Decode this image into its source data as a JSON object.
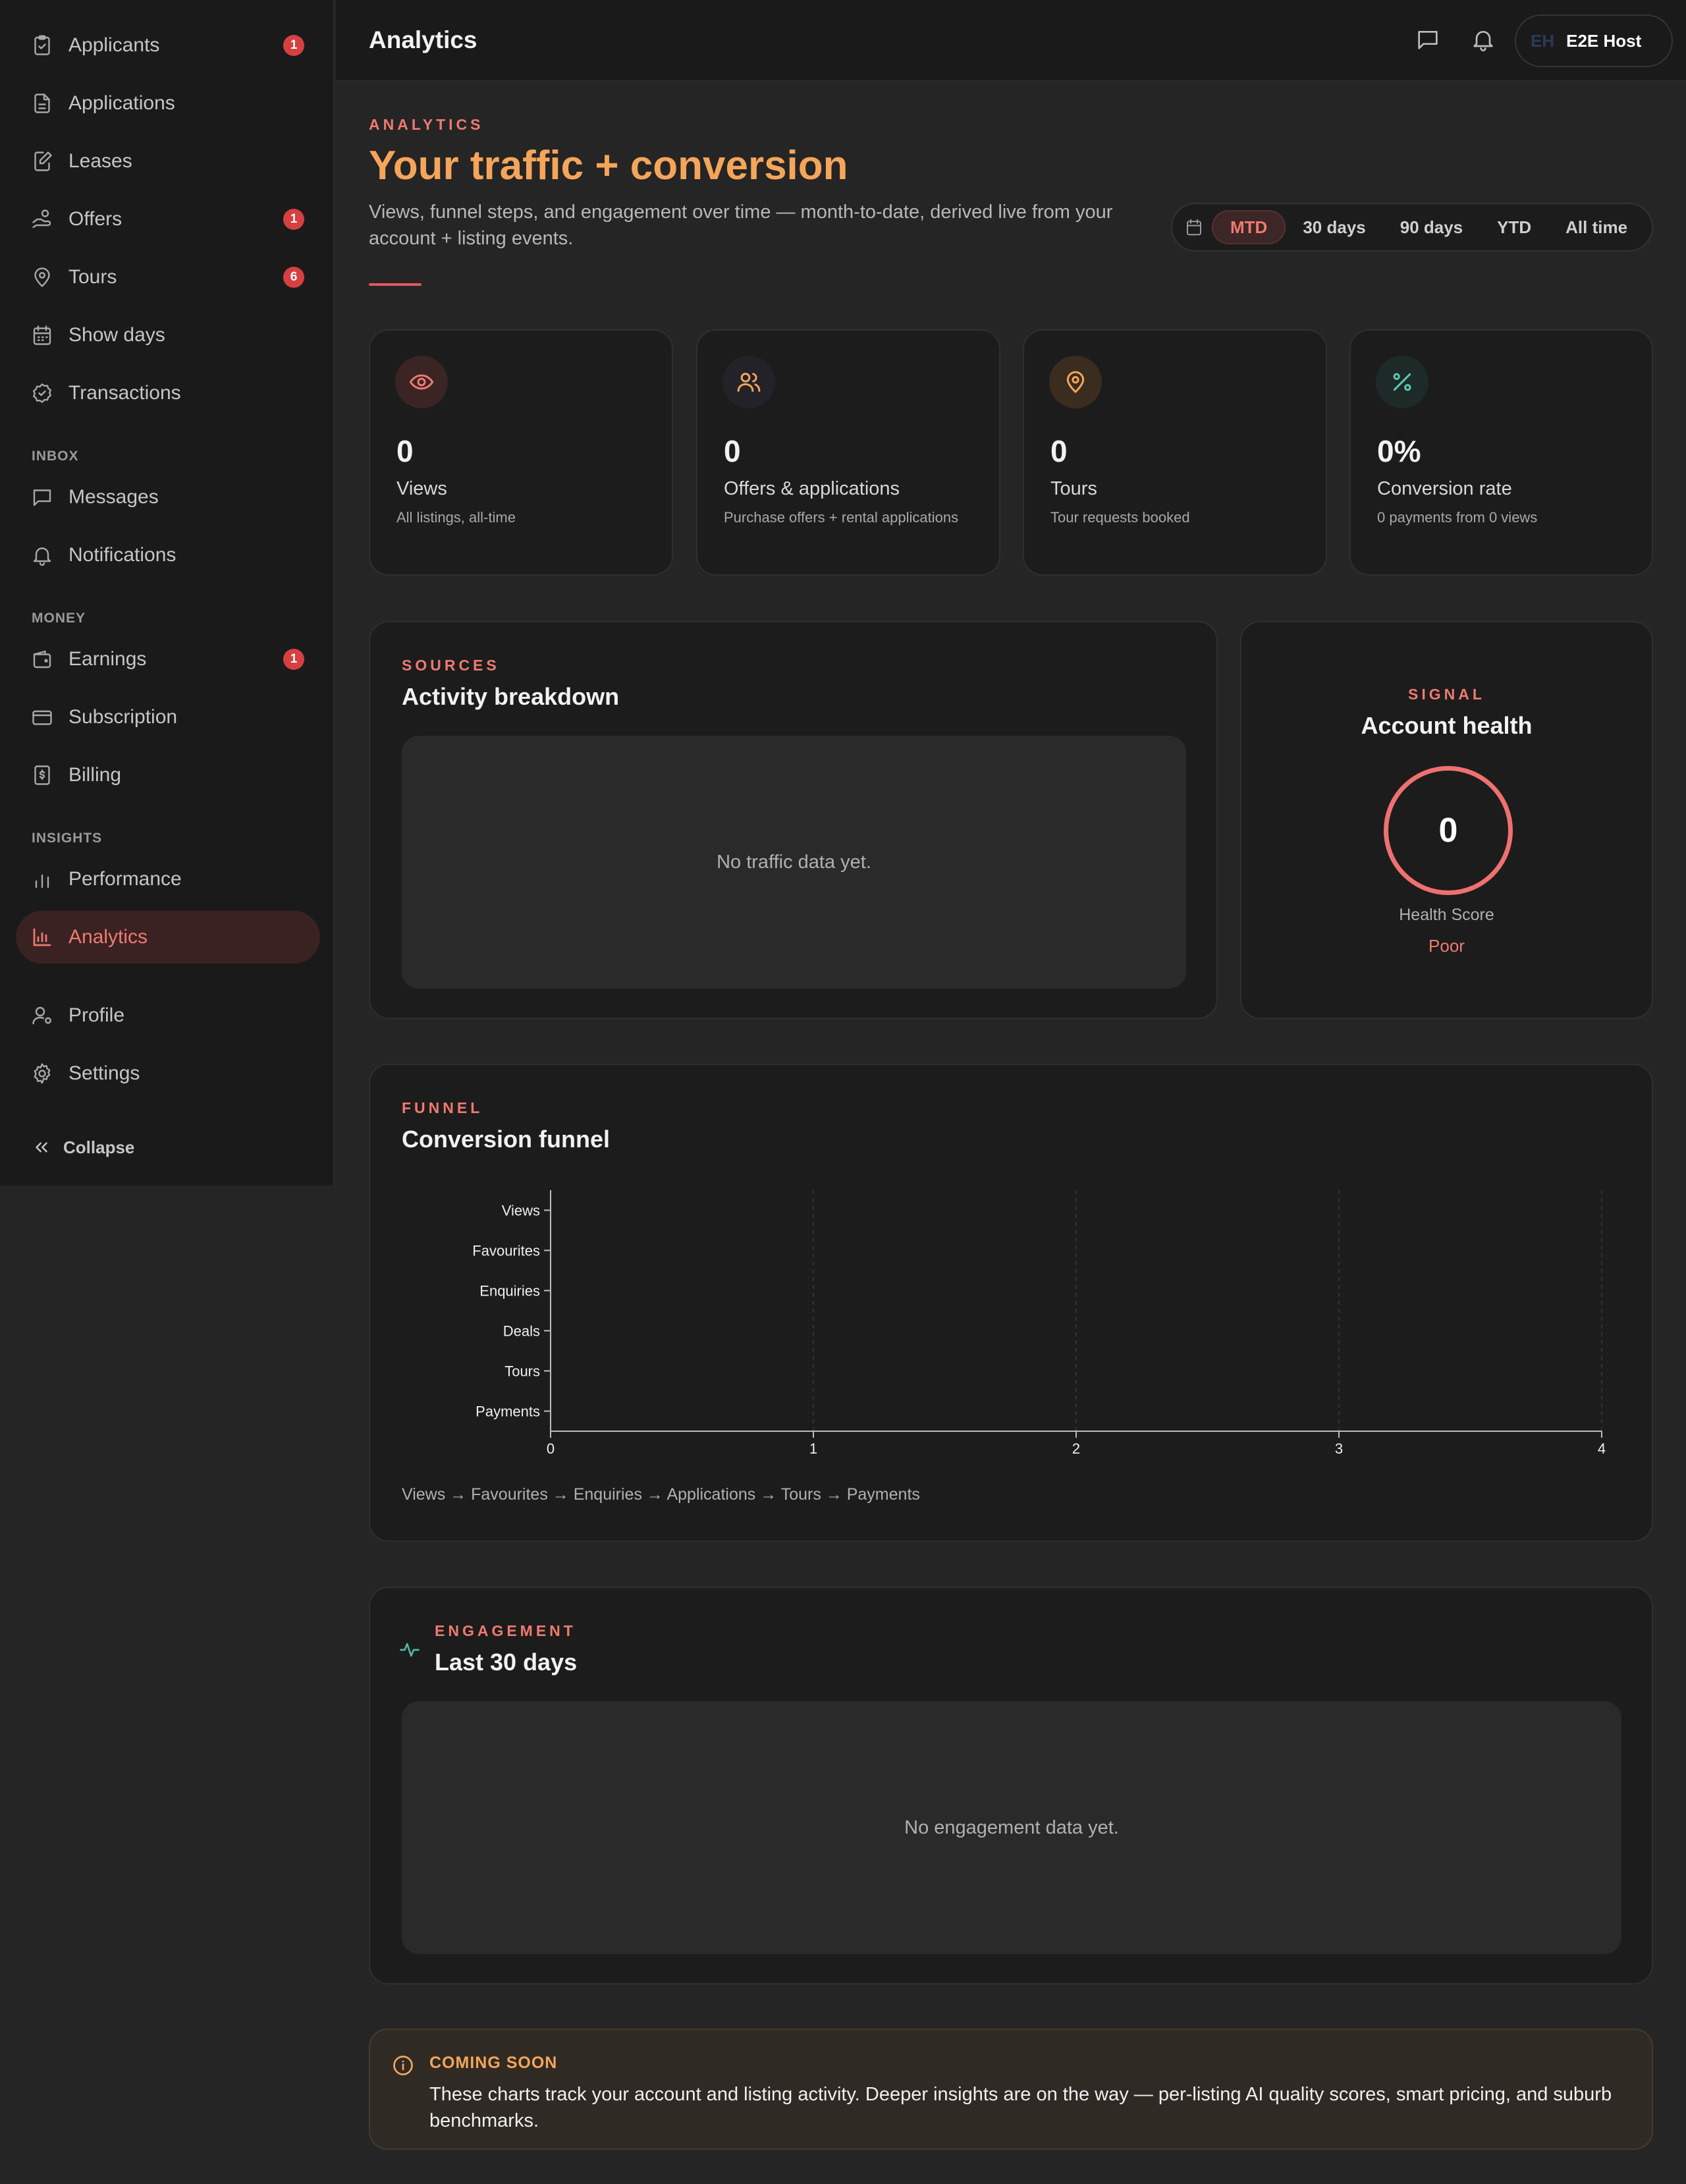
{
  "sidebar": {
    "items": [
      {
        "label": "Applicants",
        "badge": "1",
        "icon": "clipboard-icon"
      },
      {
        "label": "Applications",
        "badge": "",
        "icon": "document-icon"
      },
      {
        "label": "Leases",
        "badge": "",
        "icon": "file-edit-icon"
      },
      {
        "label": "Offers",
        "badge": "1",
        "icon": "hand-coins-icon"
      },
      {
        "label": "Tours",
        "badge": "6",
        "icon": "map-pin-icon"
      },
      {
        "label": "Show days",
        "badge": "",
        "icon": "calendar-icon"
      },
      {
        "label": "Transactions",
        "badge": "",
        "icon": "badge-check-icon"
      }
    ],
    "inbox_label": "INBOX",
    "inbox_items": [
      {
        "label": "Messages",
        "icon": "message-icon"
      },
      {
        "label": "Notifications",
        "icon": "bell-icon"
      }
    ],
    "money_label": "MONEY",
    "money_items": [
      {
        "label": "Earnings",
        "badge": "1",
        "icon": "wallet-icon"
      },
      {
        "label": "Subscription",
        "icon": "credit-card-icon"
      },
      {
        "label": "Billing",
        "icon": "receipt-icon"
      }
    ],
    "insights_label": "INSIGHTS",
    "insights_items": [
      {
        "label": "Performance",
        "icon": "bar-chart-icon"
      },
      {
        "label": "Analytics",
        "icon": "analytics-chart-icon",
        "active": true
      }
    ],
    "account_items": [
      {
        "label": "Profile",
        "icon": "user-cog-icon"
      },
      {
        "label": "Settings",
        "icon": "gear-icon"
      }
    ],
    "collapse_label": "Collapse"
  },
  "topbar": {
    "title": "Analytics",
    "account_initials": "EH",
    "account_name": "E2E Host"
  },
  "header": {
    "eyebrow": "ANALYTICS",
    "title": "Your traffic + conversion",
    "subtitle": "Views, funnel steps, and engagement over time — month-to-date, derived live from your account + listing events."
  },
  "range": {
    "options": [
      "MTD",
      "30 days",
      "90 days",
      "YTD",
      "All time"
    ],
    "selected": "MTD"
  },
  "stats": [
    {
      "value": "0",
      "name": "Views",
      "desc": "All listings, all-time",
      "icon": "eye-icon",
      "color": "#f07a70"
    },
    {
      "value": "0",
      "name": "Offers & applications",
      "desc": "Purchase offers + rental applications",
      "icon": "users-icon",
      "color": "#f5a55a"
    },
    {
      "value": "0",
      "name": "Tours",
      "desc": "Tour requests booked",
      "icon": "map-pin-icon",
      "color": "#f5a55a"
    },
    {
      "value": "0%",
      "name": "Conversion rate",
      "desc": "0 payments from 0 views",
      "icon": "percent-icon",
      "color": "#5fc9b4"
    }
  ],
  "sources": {
    "eyebrow": "SOURCES",
    "title": "Activity breakdown",
    "empty": "No traffic data yet."
  },
  "health": {
    "eyebrow": "SIGNAL",
    "title": "Account health",
    "score": "0",
    "label": "Health Score",
    "status": "Poor"
  },
  "funnel": {
    "eyebrow": "FUNNEL",
    "title": "Conversion funnel",
    "caption": "Views → Favourites → Enquiries → Applications → Tours → Payments"
  },
  "chart_data": {
    "type": "bar",
    "orientation": "horizontal",
    "categories": [
      "Views",
      "Favourites",
      "Enquiries",
      "Deals",
      "Tours",
      "Payments"
    ],
    "values": [
      0,
      0,
      0,
      0,
      0,
      0
    ],
    "xlim": [
      0,
      4
    ],
    "xticks": [
      "0",
      "1",
      "2",
      "3",
      "4"
    ],
    "grid": true
  },
  "engagement": {
    "eyebrow": "ENGAGEMENT",
    "title": "Last 30 days",
    "empty": "No engagement data yet."
  },
  "banner": {
    "heading": "COMING SOON",
    "body": "These charts track your account and listing activity. Deeper insights are on the way — per-listing AI quality scores, smart pricing, and suburb benchmarks."
  },
  "colors": {
    "accent": "#f07a70",
    "brand_orange": "#f5a55a",
    "badge_red": "#d64040"
  }
}
